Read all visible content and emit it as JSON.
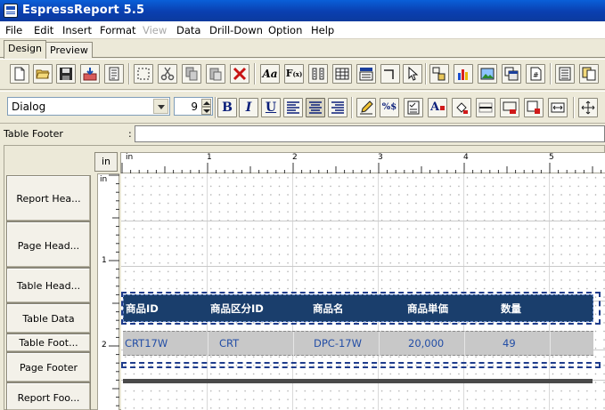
{
  "app": {
    "title": "EspressReport 5.5"
  },
  "menu": [
    {
      "label": "File",
      "disabled": false
    },
    {
      "label": "Edit",
      "disabled": false
    },
    {
      "label": "Insert",
      "disabled": false
    },
    {
      "label": "Format",
      "disabled": false
    },
    {
      "label": "View",
      "disabled": true
    },
    {
      "label": "Data",
      "disabled": false
    },
    {
      "label": "Drill-Down",
      "disabled": false
    },
    {
      "label": "Option",
      "disabled": false
    },
    {
      "label": "Help",
      "disabled": false
    }
  ],
  "tabs": {
    "design": "Design",
    "preview": "Preview",
    "active": "Design"
  },
  "format_toolbar": {
    "font_name": "Dialog",
    "font_size": "9",
    "align_center_pressed": true
  },
  "property_bar": {
    "section": "Table Footer",
    "colon": ":",
    "value": ""
  },
  "designer": {
    "unit_button": "in",
    "ruler_h_labels": [
      "in",
      "1",
      "2",
      "3",
      "4",
      "5"
    ],
    "ruler_v_labels": [
      "in",
      "1",
      "2"
    ],
    "sections": [
      "Report Hea...",
      "Page Head...",
      "Table Head...",
      "Table Data",
      "Table Foot...",
      "Page Footer",
      "Report Foo..."
    ],
    "table_header": [
      "商品ID",
      "商品区分ID",
      "商品名",
      "商品単価",
      "数量"
    ],
    "table_data": [
      "CRT17W",
      "CRT",
      "DPC-17W",
      "20,000",
      "49"
    ]
  },
  "colors": {
    "title_bar": "#0a3fb0",
    "header_band": "#1a3e6c",
    "data_text": "#234ea6",
    "data_band": "#c8c8c8"
  }
}
